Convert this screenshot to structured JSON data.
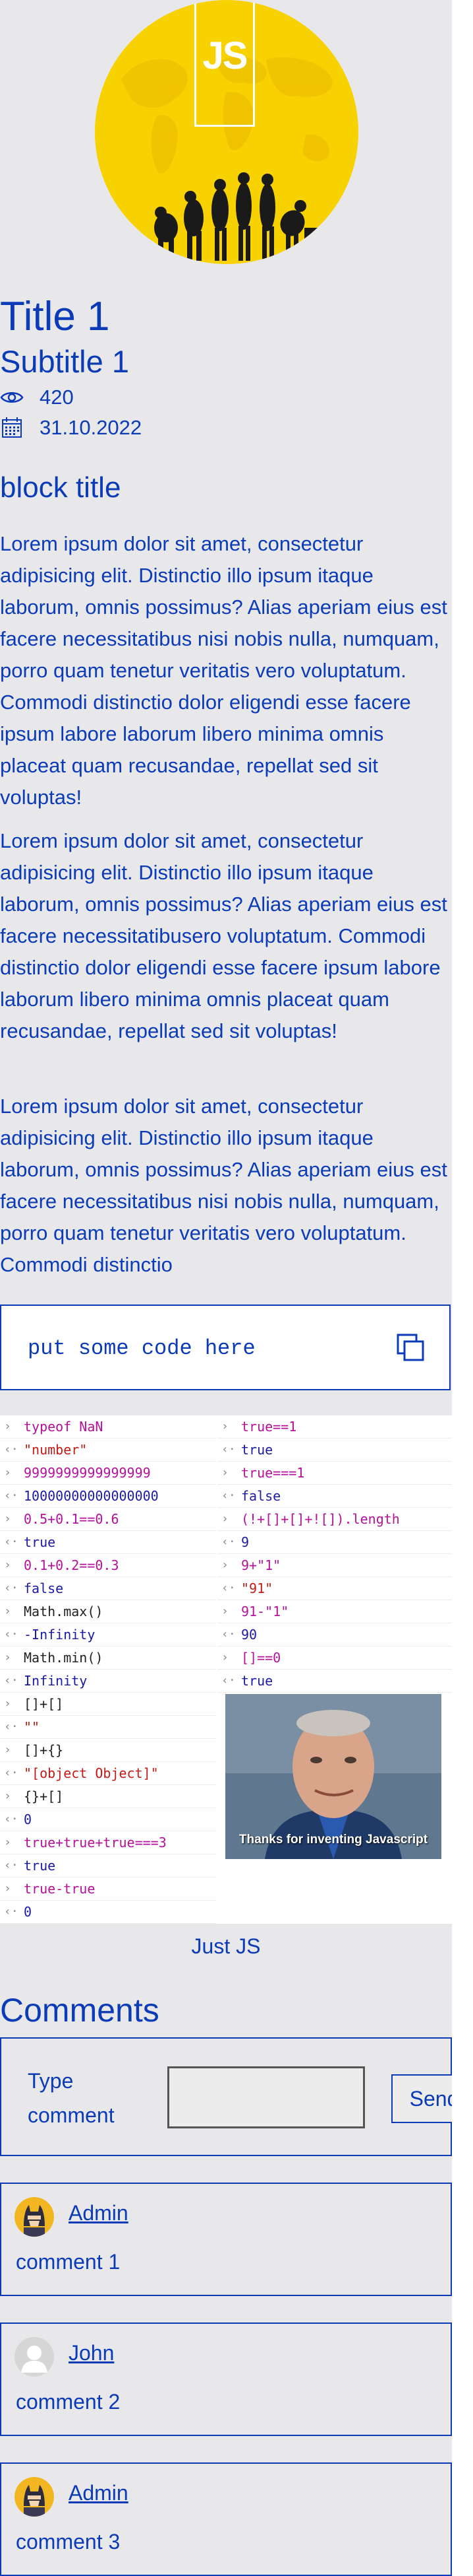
{
  "hero": {
    "logo_text": "JS",
    "image_icon": "evolution-of-man-illustration"
  },
  "article": {
    "title": "Title 1",
    "subtitle": "Subtitle 1",
    "views": "420",
    "date": "31.10.2022",
    "block_title": "block title",
    "paragraphs": [
      "Lorem ipsum dolor sit amet, consectetur adipisicing elit. Distinctio illo ipsum itaque laborum, omnis possimus? Alias aperiam eius est facere necessitatibus nisi nobis nulla, numquam, porro quam tenetur veritatis vero voluptatum. Commodi distinctio dolor eligendi esse facere ipsum labore laborum libero minima omnis placeat quam recusandae, repellat sed sit voluptas!",
      "Lorem ipsum dolor sit amet, consectetur adipisicing elit. Distinctio illo ipsum itaque laborum, omnis possimus? Alias aperiam eius est facere necessitatibusero voluptatum. Commodi distinctio dolor eligendi esse facere ipsum labore laborum libero minima omnis placeat quam recusandae, repellat sed sit voluptas!",
      "Lorem ipsum dolor sit amet, consectetur adipisicing elit. Distinctio illo ipsum itaque laborum, omnis possimus? Alias aperiam eius est facere necessitatibus nisi nobis nulla, numquam, porro quam tenetur veritatis vero voluptatum. Commodi distinctio"
    ]
  },
  "code": {
    "text": "put some code here",
    "copy_icon": "copy-icon"
  },
  "console": {
    "left": [
      {
        "input": "typeof NaN",
        "output": "\"number\"",
        "out_type": "str"
      },
      {
        "input": "9999999999999999",
        "output": "10000000000000000",
        "out_type": "res"
      },
      {
        "input": "0.5+0.1==0.6",
        "output": "true",
        "out_type": "res"
      },
      {
        "input": "0.1+0.2==0.3",
        "output": "false",
        "out_type": "res"
      },
      {
        "input": "Math.max()",
        "output": "-Infinity",
        "out_type": "res"
      },
      {
        "input": "Math.min()",
        "output": "Infinity",
        "out_type": "res"
      },
      {
        "input": "[]+[]",
        "output": "\"\"",
        "out_type": "str"
      },
      {
        "input": "[]+{}",
        "output": "\"[object Object]\"",
        "out_type": "str"
      },
      {
        "input": "{}+[]",
        "output": "0",
        "out_type": "res"
      },
      {
        "input": "true+true+true===3",
        "output": "true",
        "out_type": "res"
      },
      {
        "input": "true-true",
        "output": "0",
        "out_type": "res"
      }
    ],
    "right": [
      {
        "input": "true==1",
        "output": "true",
        "out_type": "res"
      },
      {
        "input": "true===1",
        "output": "false",
        "out_type": "res"
      },
      {
        "input": "(!+[]+[]+![]).length",
        "output": "9",
        "out_type": "res"
      },
      {
        "input": "9+\"1\"",
        "output": "\"91\"",
        "out_type": "str"
      },
      {
        "input": "91-\"1\"",
        "output": "90",
        "out_type": "res"
      },
      {
        "input": "[]==0",
        "output": "true",
        "out_type": "res"
      }
    ],
    "meme_caption": "Thanks for inventing Javascript"
  },
  "caption": "Just JS",
  "comments": {
    "title": "Comments",
    "form_label": "Type comment",
    "send_label": "Send",
    "items": [
      {
        "author": "Admin",
        "text": "comment 1",
        "avatar": "batman-avatar-icon"
      },
      {
        "author": "John",
        "text": "comment 2",
        "avatar": "default-user-avatar-icon"
      },
      {
        "author": "Admin",
        "text": "comment 3",
        "avatar": "batman-avatar-icon"
      }
    ]
  },
  "colors": {
    "accent": "#0b3bb7",
    "page_bg": "#e8e8ea",
    "hero_yellow": "#f7d200"
  }
}
